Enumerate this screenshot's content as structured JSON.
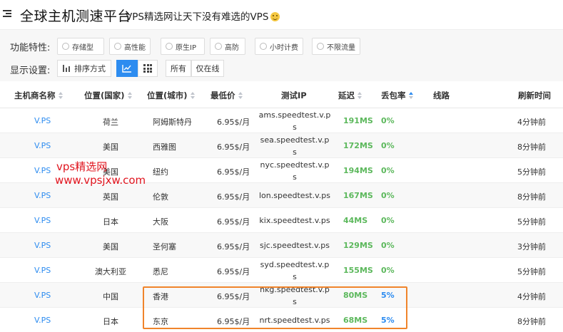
{
  "header": {
    "title": "全球主机测速平台",
    "subtitle": "VPS精选网让天下没有难选的VPS"
  },
  "filters": {
    "feature_label": "功能特性:",
    "features": [
      "存储型",
      "高性能",
      "原生IP",
      "高防",
      "小时计费",
      "不限流量"
    ],
    "display_label": "显示设置:",
    "sort_button": "排序方式",
    "scope_all": "所有",
    "scope_online": "仅在线"
  },
  "table": {
    "columns": {
      "host": "主机商名称",
      "country": "位置(国家)",
      "city": "位置(城市)",
      "price": "最低价",
      "ip": "测试IP",
      "latency": "延迟",
      "loss": "丢包率",
      "route": "线路",
      "refresh": "刷新时间"
    },
    "rows": [
      {
        "host": "V.PS",
        "country": "荷兰",
        "city": "阿姆斯特丹",
        "price": "6.95$/月",
        "ip": "ams.speedtest.v.ps",
        "latency": "191MS",
        "loss": "0%",
        "refresh": "4分钟前"
      },
      {
        "host": "V.PS",
        "country": "美国",
        "city": "西雅图",
        "price": "6.95$/月",
        "ip": "sea.speedtest.v.ps",
        "latency": "172MS",
        "loss": "0%",
        "refresh": "8分钟前"
      },
      {
        "host": "V.PS",
        "country": "美国",
        "city": "纽约",
        "price": "6.95$/月",
        "ip": "nyc.speedtest.v.ps",
        "latency": "194MS",
        "loss": "0%",
        "refresh": "5分钟前"
      },
      {
        "host": "V.PS",
        "country": "英国",
        "city": "伦敦",
        "price": "6.95$/月",
        "ip": "lon.speedtest.v.ps",
        "latency": "167MS",
        "loss": "0%",
        "refresh": "8分钟前"
      },
      {
        "host": "V.PS",
        "country": "日本",
        "city": "大阪",
        "price": "6.95$/月",
        "ip": "kix.speedtest.v.ps",
        "latency": "44MS",
        "loss": "0%",
        "refresh": "5分钟前"
      },
      {
        "host": "V.PS",
        "country": "美国",
        "city": "圣何塞",
        "price": "6.95$/月",
        "ip": "sjc.speedtest.v.ps",
        "latency": "129MS",
        "loss": "0%",
        "refresh": "3分钟前"
      },
      {
        "host": "V.PS",
        "country": "澳大利亚",
        "city": "悉尼",
        "price": "6.95$/月",
        "ip": "syd.speedtest.v.ps",
        "latency": "155MS",
        "loss": "0%",
        "refresh": "5分钟前"
      },
      {
        "host": "V.PS",
        "country": "中国",
        "city": "香港",
        "price": "6.95$/月",
        "ip": "hkg.speedtest.v.ps",
        "latency": "80MS",
        "loss": "5%",
        "refresh": "4分钟前"
      },
      {
        "host": "V.PS",
        "country": "日本",
        "city": "东京",
        "price": "6.95$/月",
        "ip": "nrt.speedtest.v.ps",
        "latency": "68MS",
        "loss": "5%",
        "refresh": "8分钟前"
      }
    ]
  },
  "watermark": {
    "line1": "vps精选网",
    "line2": "www.vpsjxw.com"
  },
  "colors": {
    "accent": "#2d8cf0",
    "latency_green": "#5cb85c",
    "highlight_orange": "#f0842b",
    "watermark_red": "#e0141e"
  }
}
